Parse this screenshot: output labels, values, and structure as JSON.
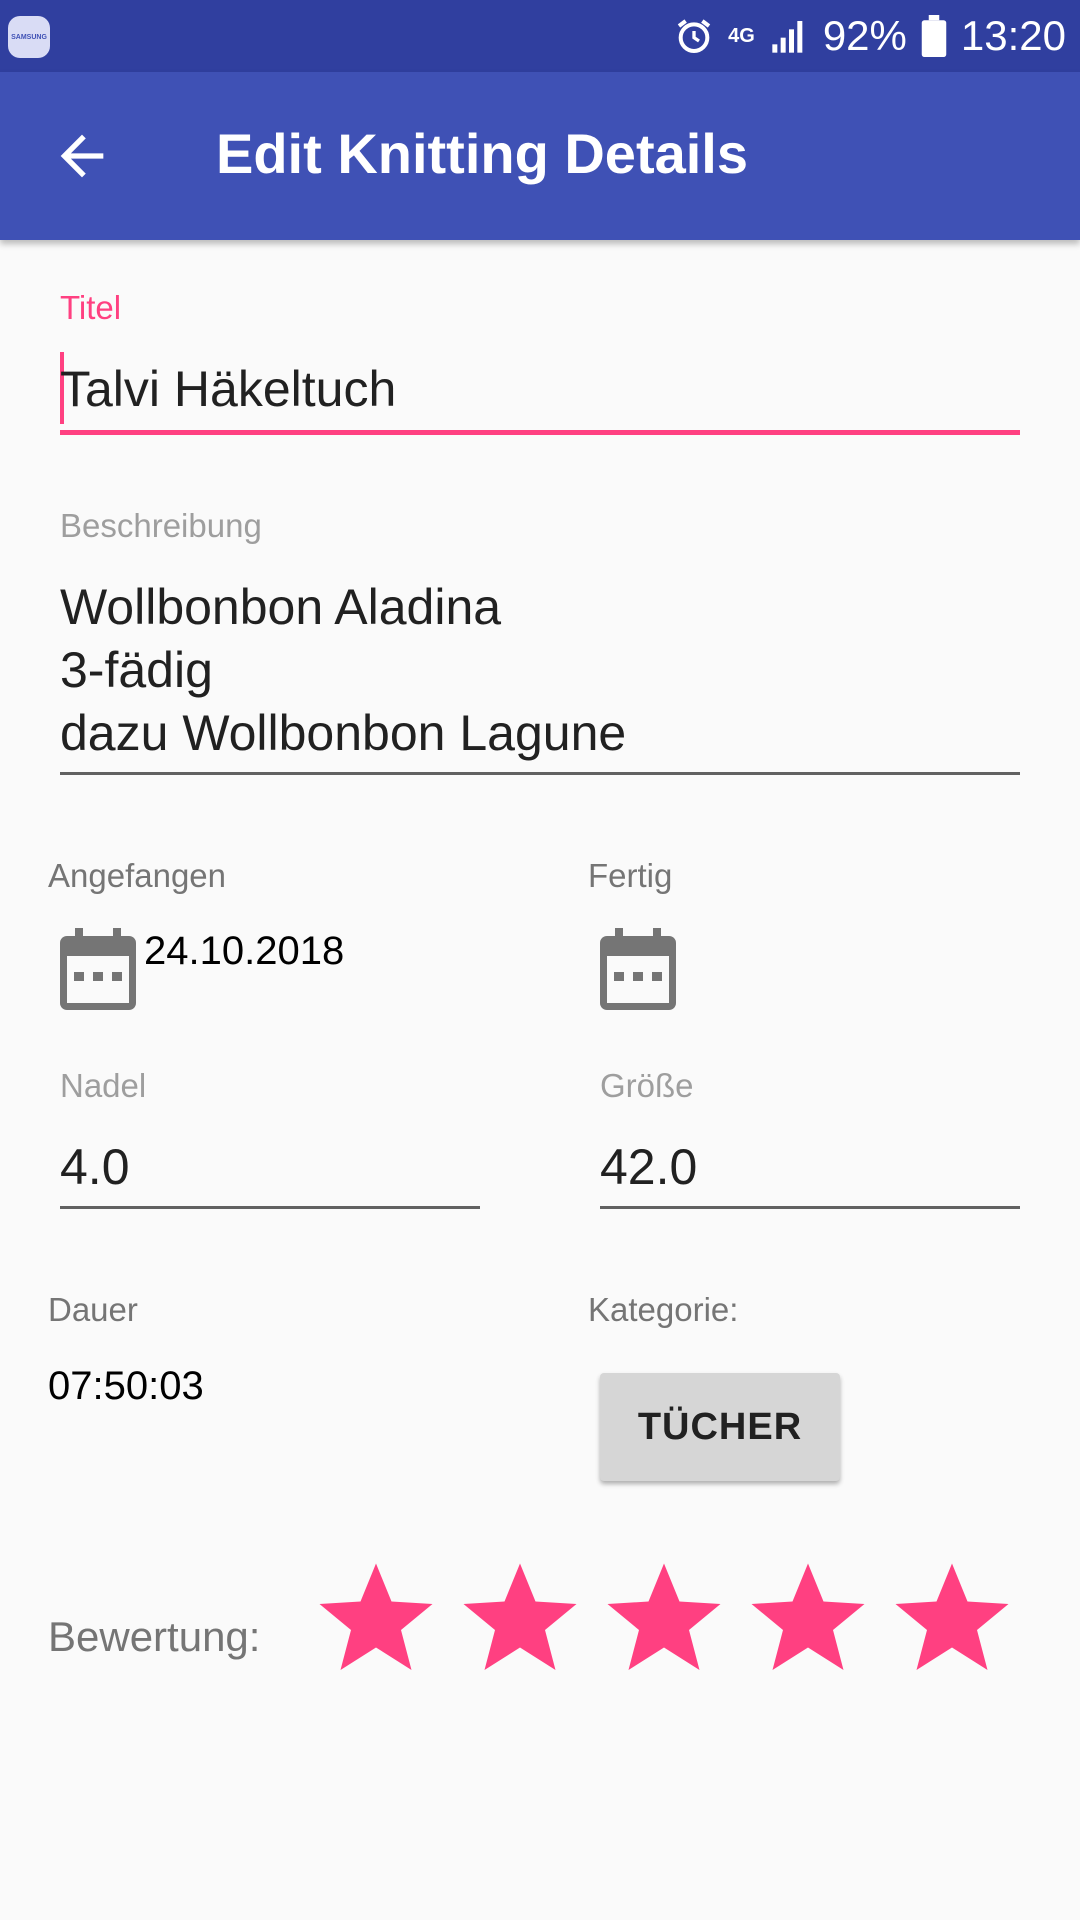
{
  "status_bar": {
    "network": "4G",
    "battery": "92%",
    "time": "13:20"
  },
  "app_bar": {
    "title": "Edit Knitting Details"
  },
  "form": {
    "title": {
      "label": "Titel",
      "value": "Talvi Häkeltuch"
    },
    "description": {
      "label": "Beschreibung",
      "lines": [
        "Wollbonbon Aladina",
        "3-fädig",
        "dazu Wollbonbon Lagune"
      ]
    },
    "started": {
      "label": "Angefangen",
      "value": "24.10.2018"
    },
    "finished": {
      "label": "Fertig",
      "value": ""
    },
    "needle": {
      "label": "Nadel",
      "value": "4.0"
    },
    "size": {
      "label": "Größe",
      "value": "42.0"
    },
    "duration": {
      "label": "Dauer",
      "value": "07:50:03"
    },
    "category": {
      "label": "Kategorie:",
      "button": "TÜCHER"
    },
    "rating": {
      "label": "Bewertung:",
      "value": 5,
      "max": 5,
      "color": "#ff4081"
    }
  },
  "colors": {
    "primary": "#3f51b5",
    "primary_dark": "#303f9f",
    "accent": "#ff4081"
  }
}
